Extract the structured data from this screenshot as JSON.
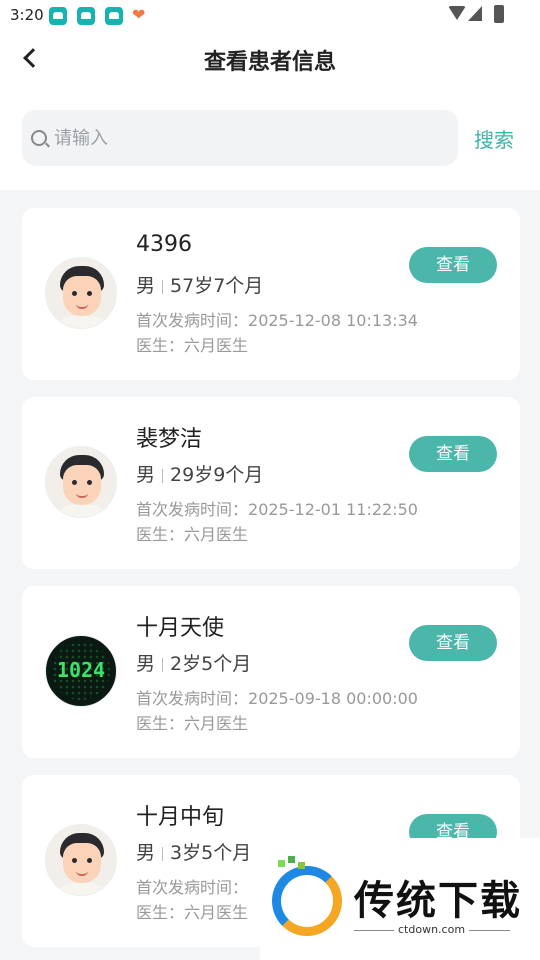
{
  "status_bar": {
    "time": "3:20",
    "apps": [
      {
        "icon": "car-app-icon"
      },
      {
        "icon": "car-app-icon"
      },
      {
        "icon": "car-app-icon"
      },
      {
        "icon": "heart-app-icon"
      }
    ]
  },
  "header": {
    "title": "查看患者信息"
  },
  "search": {
    "placeholder": "请输入",
    "value": "",
    "button_label": "搜索"
  },
  "patients": [
    {
      "name": "4396",
      "gender": "男",
      "age": "57岁7个月",
      "onset_label": "首次发病时间：",
      "onset_time": "2025-12-08 10:13:34",
      "doctor_label": "医生：",
      "doctor": "六月医生",
      "avatar": "cartoon-man",
      "button_label": "查看"
    },
    {
      "name": "裴梦洁",
      "gender": "男",
      "age": "29岁9个月",
      "onset_label": "首次发病时间：",
      "onset_time": "2025-12-01 11:22:50",
      "doctor_label": "医生：",
      "doctor": "六月医生",
      "avatar": "cartoon-man",
      "button_label": "查看"
    },
    {
      "name": "十月天使",
      "gender": "男",
      "age": "2岁5个月",
      "onset_label": "首次发病时间：",
      "onset_time": "2025-09-18 00:00:00",
      "doctor_label": "医生：",
      "doctor": "六月医生",
      "avatar": "code-1024",
      "avatar_text": "1024",
      "button_label": "查看"
    },
    {
      "name": "十月中旬",
      "gender": "男",
      "age": "3岁5个月",
      "onset_label": "首次发病时间：",
      "onset_time": "",
      "doctor_label": "医生：",
      "doctor": "六月医生",
      "avatar": "cartoon-man",
      "button_label": "查看"
    }
  ],
  "watermark": {
    "brand": "传统下载",
    "url": "ctdown.com"
  },
  "colors": {
    "accent": "#4bb7ab",
    "search_text": "#3fb3a8",
    "background": "#f4f5f7"
  }
}
